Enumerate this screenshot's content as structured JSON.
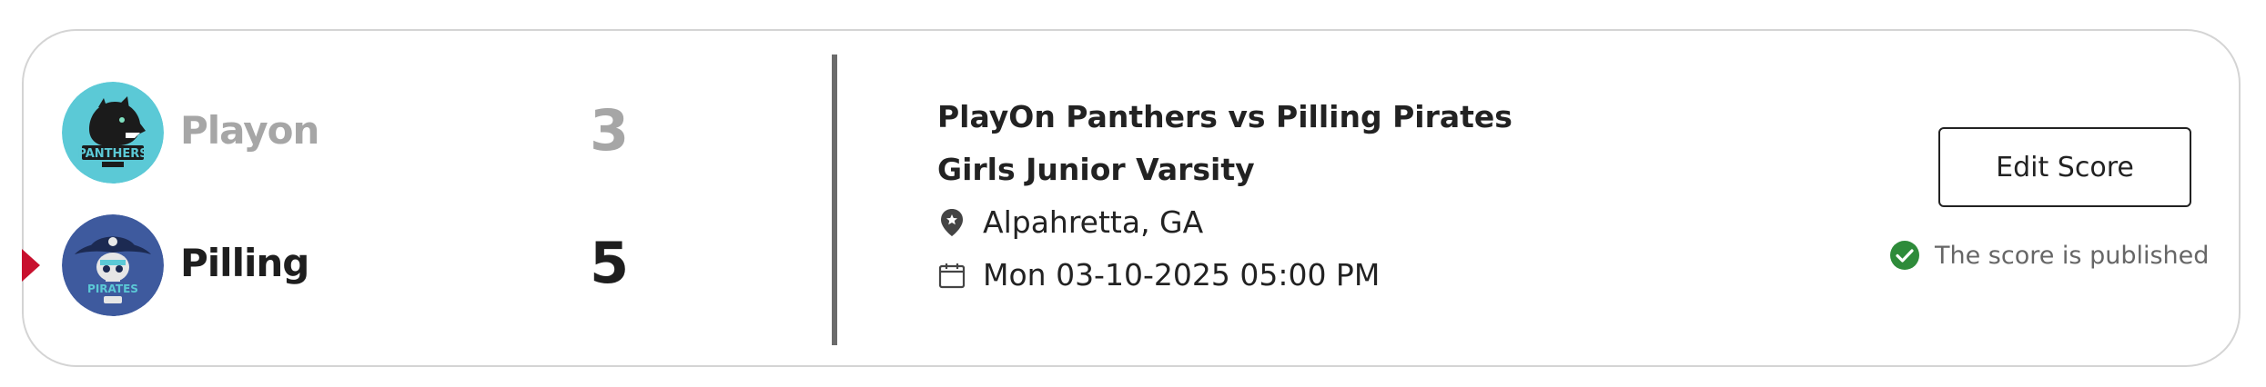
{
  "colors": {
    "accent_winner": "#c8102e",
    "panthers_logo_bg": "#5bc9d6",
    "pirates_logo_bg": "#3e5a9e",
    "published_check": "#2e8b3a"
  },
  "teams": [
    {
      "name": "Playon",
      "score": "3",
      "logo_icon": "panthers-logo",
      "logo_text": "PANTHERS",
      "winner": false
    },
    {
      "name": "Pilling",
      "score": "5",
      "logo_icon": "pirates-logo",
      "logo_text": "PIRATES",
      "winner": true
    }
  ],
  "game": {
    "title": "PlayOn Panthers vs Pilling Pirates",
    "level": "Girls Junior Varsity",
    "location": "Alpahretta, GA",
    "location_icon": "map-pin-icon",
    "datetime": "Mon 03-10-2025 05:00 PM",
    "datetime_icon": "calendar-icon"
  },
  "actions": {
    "edit_score_label": "Edit Score"
  },
  "status": {
    "text": "The score is published",
    "icon": "check-circle-icon"
  }
}
